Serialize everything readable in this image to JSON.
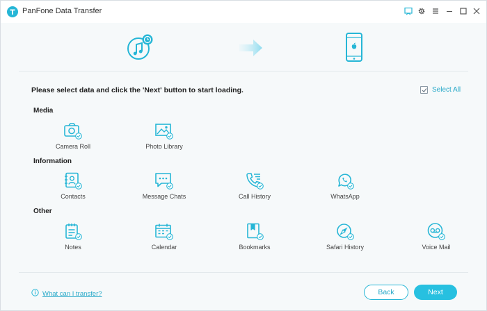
{
  "app": {
    "title": "PanFone Data Transfer",
    "logo_letter": "T"
  },
  "colors": {
    "accent": "#26b6d6",
    "text": "#333333",
    "background": "#f6f9fa"
  },
  "titlebar_icons": [
    "feedback-icon",
    "gear-icon",
    "menu-icon",
    "minimize-icon",
    "maximize-icon",
    "close-icon"
  ],
  "instruction": "Please select data and click the 'Next' button to start loading.",
  "select_all": {
    "label": "Select All",
    "checked": true
  },
  "sections": {
    "media": {
      "title": "Media",
      "items": [
        {
          "label": "Camera Roll",
          "icon": "camera-icon",
          "checked": true
        },
        {
          "label": "Photo Library",
          "icon": "photo-icon",
          "checked": true
        }
      ]
    },
    "information": {
      "title": "Information",
      "items": [
        {
          "label": "Contacts",
          "icon": "contacts-icon",
          "checked": true
        },
        {
          "label": "Message Chats",
          "icon": "message-icon",
          "checked": true
        },
        {
          "label": "Call History",
          "icon": "call-history-icon",
          "checked": true
        },
        {
          "label": "WhatsApp",
          "icon": "whatsapp-icon",
          "checked": true
        }
      ]
    },
    "other": {
      "title": "Other",
      "items": [
        {
          "label": "Notes",
          "icon": "notes-icon",
          "checked": true
        },
        {
          "label": "Calendar",
          "icon": "calendar-icon",
          "checked": true
        },
        {
          "label": "Bookmarks",
          "icon": "bookmark-icon",
          "checked": true
        },
        {
          "label": "Safari History",
          "icon": "compass-icon",
          "checked": true
        },
        {
          "label": "Voice Mail",
          "icon": "voicemail-icon",
          "checked": true
        }
      ]
    }
  },
  "help_link": "What can I transfer?",
  "buttons": {
    "back": "Back",
    "next": "Next"
  }
}
